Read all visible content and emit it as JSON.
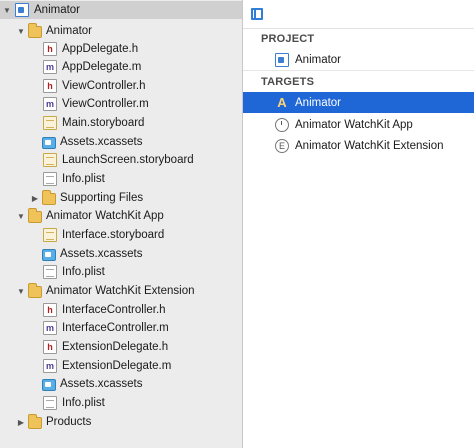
{
  "navigator": {
    "rows": [
      {
        "label": "Animator",
        "icon": "project-icon"
      },
      {
        "label": "Animator",
        "icon": "folder-icon"
      },
      {
        "label": "AppDelegate.h",
        "icon": "header-file-icon"
      },
      {
        "label": "AppDelegate.m",
        "icon": "source-file-icon"
      },
      {
        "label": "ViewController.h",
        "icon": "header-file-icon"
      },
      {
        "label": "ViewController.m",
        "icon": "source-file-icon"
      },
      {
        "label": "Main.storyboard",
        "icon": "storyboard-icon"
      },
      {
        "label": "Assets.xcassets",
        "icon": "asset-catalog-icon"
      },
      {
        "label": "LaunchScreen.storyboard",
        "icon": "storyboard-icon"
      },
      {
        "label": "Info.plist",
        "icon": "plist-icon"
      },
      {
        "label": "Supporting Files",
        "icon": "folder-icon"
      },
      {
        "label": "Animator WatchKit App",
        "icon": "folder-icon"
      },
      {
        "label": "Interface.storyboard",
        "icon": "storyboard-icon"
      },
      {
        "label": "Assets.xcassets",
        "icon": "asset-catalog-icon"
      },
      {
        "label": "Info.plist",
        "icon": "plist-icon"
      },
      {
        "label": "Animator WatchKit Extension",
        "icon": "folder-icon"
      },
      {
        "label": "InterfaceController.h",
        "icon": "header-file-icon"
      },
      {
        "label": "InterfaceController.m",
        "icon": "source-file-icon"
      },
      {
        "label": "ExtensionDelegate.h",
        "icon": "header-file-icon"
      },
      {
        "label": "ExtensionDelegate.m",
        "icon": "source-file-icon"
      },
      {
        "label": "Assets.xcassets",
        "icon": "asset-catalog-icon"
      },
      {
        "label": "Info.plist",
        "icon": "plist-icon"
      },
      {
        "label": "Products",
        "icon": "folder-icon"
      }
    ]
  },
  "editor": {
    "toolbar": {
      "toggle_icon": "sidebar-toggle-icon"
    },
    "project_header": "PROJECT",
    "project_item": "Animator",
    "targets_header": "TARGETS",
    "targets": [
      {
        "label": "Animator",
        "icon": "app-target-icon",
        "selected": true
      },
      {
        "label": "Animator WatchKit App",
        "icon": "watch-app-icon",
        "selected": false
      },
      {
        "label": "Animator WatchKit Extension",
        "icon": "extension-icon",
        "selected": false
      }
    ],
    "selection_color": "#1f66d6"
  }
}
